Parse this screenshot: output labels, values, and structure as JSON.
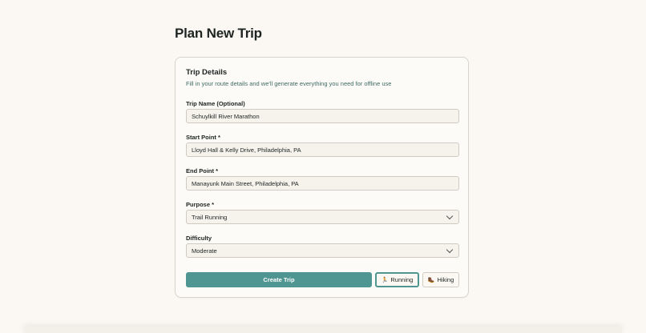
{
  "page": {
    "title": "Plan New Trip"
  },
  "card": {
    "title": "Trip Details",
    "description": "Fill in your route details and we'll generate everything you need for offline use"
  },
  "form": {
    "trip_name": {
      "label": "Trip Name (Optional)",
      "value": "Schuylkill River Marathon"
    },
    "start_point": {
      "label": "Start Point *",
      "value": "Lloyd Hall & Kelly Drive, Philadelphia, PA"
    },
    "end_point": {
      "label": "End Point *",
      "value": "Manayunk Main Street, Philadelphia, PA"
    },
    "purpose": {
      "label": "Purpose *",
      "value": "Trail Running"
    },
    "difficulty": {
      "label": "Difficulty",
      "value": "Moderate"
    }
  },
  "actions": {
    "create_label": "Create Trip",
    "presets": [
      {
        "label": "Running",
        "icon": "runner-icon",
        "glyph": "🏃",
        "active": true
      },
      {
        "label": "Hiking",
        "icon": "hiking-boot-icon",
        "glyph": "🥾",
        "active": false
      }
    ]
  },
  "colors": {
    "accent": "#4f9591",
    "background": "#fbf8f3",
    "description_text": "#3f6a66"
  }
}
